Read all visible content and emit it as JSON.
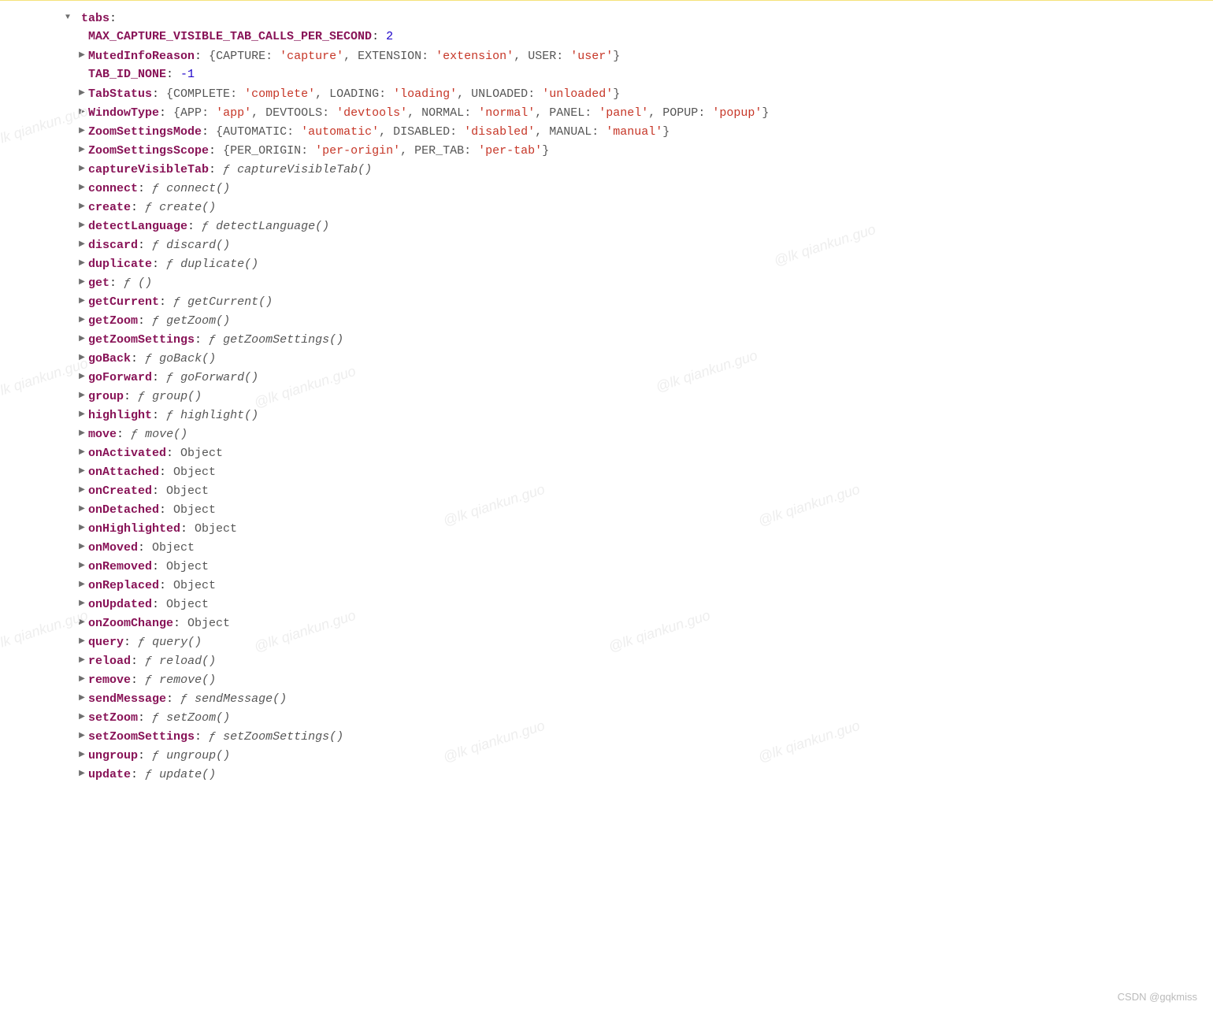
{
  "root": {
    "key": "tabs",
    "colon": ":"
  },
  "rows": [
    {
      "arrow": "blank",
      "key": "MAX_CAPTURE_VISIBLE_TAB_CALLS_PER_SECOND",
      "kind": "number",
      "value": "2"
    },
    {
      "arrow": "closed",
      "key": "MutedInfoReason",
      "kind": "enum",
      "pairs": [
        {
          "k": "CAPTURE",
          "v": "'capture'"
        },
        {
          "k": "EXTENSION",
          "v": "'extension'"
        },
        {
          "k": "USER",
          "v": "'user'"
        }
      ]
    },
    {
      "arrow": "blank",
      "key": "TAB_ID_NONE",
      "kind": "number",
      "value": "-1"
    },
    {
      "arrow": "closed",
      "key": "TabStatus",
      "kind": "enum",
      "pairs": [
        {
          "k": "COMPLETE",
          "v": "'complete'"
        },
        {
          "k": "LOADING",
          "v": "'loading'"
        },
        {
          "k": "UNLOADED",
          "v": "'unloaded'"
        }
      ]
    },
    {
      "arrow": "closed",
      "key": "WindowType",
      "kind": "enum",
      "pairs": [
        {
          "k": "APP",
          "v": "'app'"
        },
        {
          "k": "DEVTOOLS",
          "v": "'devtools'"
        },
        {
          "k": "NORMAL",
          "v": "'normal'"
        },
        {
          "k": "PANEL",
          "v": "'panel'"
        },
        {
          "k": "POPUP",
          "v": "'popup'"
        }
      ]
    },
    {
      "arrow": "closed",
      "key": "ZoomSettingsMode",
      "kind": "enum",
      "pairs": [
        {
          "k": "AUTOMATIC",
          "v": "'automatic'"
        },
        {
          "k": "DISABLED",
          "v": "'disabled'"
        },
        {
          "k": "MANUAL",
          "v": "'manual'"
        }
      ]
    },
    {
      "arrow": "closed",
      "key": "ZoomSettingsScope",
      "kind": "enum",
      "pairs": [
        {
          "k": "PER_ORIGIN",
          "v": "'per-origin'"
        },
        {
          "k": "PER_TAB",
          "v": "'per-tab'"
        }
      ]
    },
    {
      "arrow": "closed",
      "key": "captureVisibleTab",
      "kind": "func",
      "sig": "captureVisibleTab()"
    },
    {
      "arrow": "closed",
      "key": "connect",
      "kind": "func",
      "sig": "connect()"
    },
    {
      "arrow": "closed",
      "key": "create",
      "kind": "func",
      "sig": "create()"
    },
    {
      "arrow": "closed",
      "key": "detectLanguage",
      "kind": "func",
      "sig": "detectLanguage()"
    },
    {
      "arrow": "closed",
      "key": "discard",
      "kind": "func",
      "sig": "discard()"
    },
    {
      "arrow": "closed",
      "key": "duplicate",
      "kind": "func",
      "sig": "duplicate()"
    },
    {
      "arrow": "closed",
      "key": "get",
      "kind": "func",
      "sig": "()"
    },
    {
      "arrow": "closed",
      "key": "getCurrent",
      "kind": "func",
      "sig": "getCurrent()"
    },
    {
      "arrow": "closed",
      "key": "getZoom",
      "kind": "func",
      "sig": "getZoom()"
    },
    {
      "arrow": "closed",
      "key": "getZoomSettings",
      "kind": "func",
      "sig": "getZoomSettings()"
    },
    {
      "arrow": "closed",
      "key": "goBack",
      "kind": "func",
      "sig": "goBack()"
    },
    {
      "arrow": "closed",
      "key": "goForward",
      "kind": "func",
      "sig": "goForward()"
    },
    {
      "arrow": "closed",
      "key": "group",
      "kind": "func",
      "sig": "group()"
    },
    {
      "arrow": "closed",
      "key": "highlight",
      "kind": "func",
      "sig": "highlight()"
    },
    {
      "arrow": "closed",
      "key": "move",
      "kind": "func",
      "sig": "move()"
    },
    {
      "arrow": "closed",
      "key": "onActivated",
      "kind": "object",
      "value": "Object"
    },
    {
      "arrow": "closed",
      "key": "onAttached",
      "kind": "object",
      "value": "Object"
    },
    {
      "arrow": "closed",
      "key": "onCreated",
      "kind": "object",
      "value": "Object"
    },
    {
      "arrow": "closed",
      "key": "onDetached",
      "kind": "object",
      "value": "Object"
    },
    {
      "arrow": "closed",
      "key": "onHighlighted",
      "kind": "object",
      "value": "Object"
    },
    {
      "arrow": "closed",
      "key": "onMoved",
      "kind": "object",
      "value": "Object"
    },
    {
      "arrow": "closed",
      "key": "onRemoved",
      "kind": "object",
      "value": "Object"
    },
    {
      "arrow": "closed",
      "key": "onReplaced",
      "kind": "object",
      "value": "Object"
    },
    {
      "arrow": "closed",
      "key": "onUpdated",
      "kind": "object",
      "value": "Object"
    },
    {
      "arrow": "closed",
      "key": "onZoomChange",
      "kind": "object",
      "value": "Object"
    },
    {
      "arrow": "closed",
      "key": "query",
      "kind": "func",
      "sig": "query()"
    },
    {
      "arrow": "closed",
      "key": "reload",
      "kind": "func",
      "sig": "reload()"
    },
    {
      "arrow": "closed",
      "key": "remove",
      "kind": "func",
      "sig": "remove()"
    },
    {
      "arrow": "closed",
      "key": "sendMessage",
      "kind": "func",
      "sig": "sendMessage()"
    },
    {
      "arrow": "closed",
      "key": "setZoom",
      "kind": "func",
      "sig": "setZoom()"
    },
    {
      "arrow": "closed",
      "key": "setZoomSettings",
      "kind": "func",
      "sig": "setZoomSettings()"
    },
    {
      "arrow": "closed",
      "key": "ungroup",
      "kind": "func",
      "sig": "ungroup()"
    },
    {
      "arrow": "closed",
      "key": "update",
      "kind": "func",
      "sig": "update()"
    }
  ],
  "glyphs": {
    "f": "ƒ"
  },
  "watermark": "@lk qiankun.guo",
  "credit": "CSDN @gqkmiss"
}
